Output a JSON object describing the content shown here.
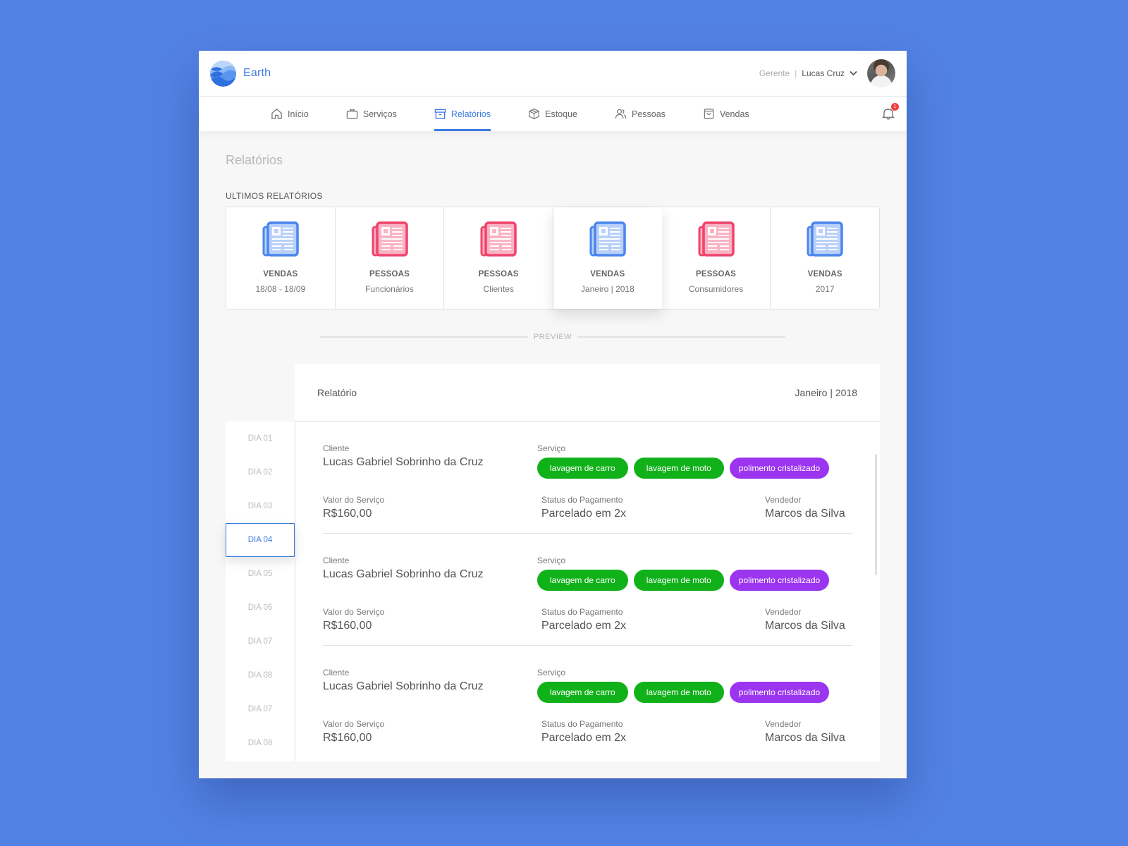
{
  "app": {
    "name": "Earth",
    "brand_color": "#3d7be0"
  },
  "user": {
    "role": "Gerente",
    "separator": "|",
    "name": "Lucas Cruz"
  },
  "nav": {
    "items": [
      {
        "label": "Início",
        "icon": "home-icon"
      },
      {
        "label": "Serviços",
        "icon": "briefcase-icon"
      },
      {
        "label": "Relatórios",
        "icon": "archive-box-icon",
        "active": true
      },
      {
        "label": "Estoque",
        "icon": "package-icon"
      },
      {
        "label": "Pessoas",
        "icon": "people-icon"
      },
      {
        "label": "Vendas",
        "icon": "shopping-bag-icon"
      }
    ],
    "notifications_count": "1"
  },
  "page": {
    "title": "Relatórios",
    "section_label": "ULTIMOS RELATÓRIOS",
    "preview_label": "PREVIEW"
  },
  "reports": [
    {
      "type": "VENDAS",
      "subtitle": "18/08  -  18/09",
      "color": "blue"
    },
    {
      "type": "PESSOAS",
      "subtitle": "Funcionários",
      "color": "pink"
    },
    {
      "type": "PESSOAS",
      "subtitle": "Clientes",
      "color": "pink"
    },
    {
      "type": "VENDAS",
      "subtitle": "Janeiro | 2018",
      "color": "blue",
      "selected": true
    },
    {
      "type": "PESSOAS",
      "subtitle": "Consumidores",
      "color": "pink"
    },
    {
      "type": "VENDAS",
      "subtitle": "2017",
      "color": "blue"
    }
  ],
  "days": [
    "DIA 01",
    "DIA 02",
    "DIA 03",
    "DIA 04",
    "DIA 05",
    "DIA 06",
    "DIA 07",
    "DIA 08",
    "DIA 07",
    "DIA 08"
  ],
  "active_day": "DIA 04",
  "report_preview": {
    "title": "Relatório",
    "date": "Janeiro | 2018",
    "labels": {
      "client": "Cliente",
      "service": "Serviço",
      "value": "Valor do Serviço",
      "payment_status": "Status do Pagamento",
      "seller": "Vendedor"
    },
    "entries": [
      {
        "client": "Lucas Gabriel Sobrinho da Cruz",
        "services": [
          {
            "label": "lavagem de carro",
            "color": "green"
          },
          {
            "label": "lavagem de moto",
            "color": "green"
          },
          {
            "label": "polimento cristalizado",
            "color": "purple"
          }
        ],
        "value": "R$160,00",
        "payment_status": "Parcelado em 2x",
        "seller": "Marcos da Silva"
      },
      {
        "client": "Lucas Gabriel Sobrinho da Cruz",
        "services": [
          {
            "label": "lavagem de carro",
            "color": "green"
          },
          {
            "label": "lavagem de moto",
            "color": "green"
          },
          {
            "label": "polimento cristalizado",
            "color": "purple"
          }
        ],
        "value": "R$160,00",
        "payment_status": "Parcelado em 2x",
        "seller": "Marcos da Silva"
      },
      {
        "client": "Lucas Gabriel Sobrinho da Cruz",
        "services": [
          {
            "label": "lavagem de carro",
            "color": "green"
          },
          {
            "label": "lavagem de moto",
            "color": "green"
          },
          {
            "label": "polimento cristalizado",
            "color": "purple"
          }
        ],
        "value": "R$160,00",
        "payment_status": "Parcelado em 2x",
        "seller": "Marcos da Silva"
      }
    ]
  },
  "colors": {
    "background": "#5282e4",
    "chip_green": "#11b11a",
    "chip_purple": "#9b35ef",
    "report_blue": "#4a86ec",
    "report_pink": "#f0436c",
    "badge_red": "#f04040"
  }
}
